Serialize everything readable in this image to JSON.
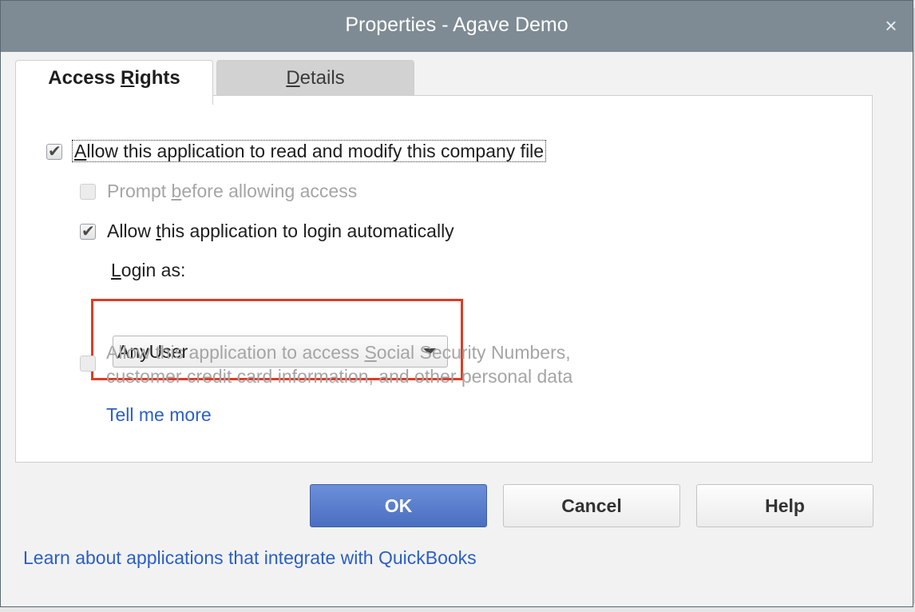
{
  "window": {
    "title": "Properties - Agave Demo",
    "close_glyph": "×"
  },
  "tabs": [
    {
      "label_pre": "Access ",
      "label_key": "R",
      "label_post": "ights",
      "active": true
    },
    {
      "label_pre": "",
      "label_key": "D",
      "label_post": "etails",
      "active": false
    }
  ],
  "access_rights": {
    "allow_read_modify": {
      "pre": "",
      "key": "A",
      "post": "llow this application to read and modify this company file",
      "checked": true
    },
    "prompt_before": {
      "pre": "Prompt ",
      "key": "b",
      "post": "efore allowing access",
      "checked": false,
      "disabled": true
    },
    "login_automatically": {
      "pre": "Allow ",
      "key": "t",
      "post": "his application to login automatically",
      "checked": true
    },
    "login_as": {
      "pre": "",
      "key": "L",
      "post": "ogin as:",
      "value": "AnyUser"
    },
    "personal_data": {
      "line1_pre": "Allow this application to access ",
      "line1_key": "S",
      "line1_post": "ocial Security Numbers,",
      "line2": "customer credit card information, and other personal data",
      "checked": false,
      "disabled": true
    },
    "tell_me_more": "Tell me more"
  },
  "buttons": {
    "ok": "OK",
    "cancel": "Cancel",
    "help": "Help"
  },
  "footer_link": "Learn about applications that integrate with QuickBooks",
  "colors": {
    "titlebar": "#7e8b94",
    "primary_button": "#5a7fd0",
    "link": "#2a5fc6",
    "highlight": "#e03b25"
  },
  "icons": {
    "checkmark": "✔",
    "close": "close-icon",
    "dropdown": "chevron-down-icon"
  }
}
